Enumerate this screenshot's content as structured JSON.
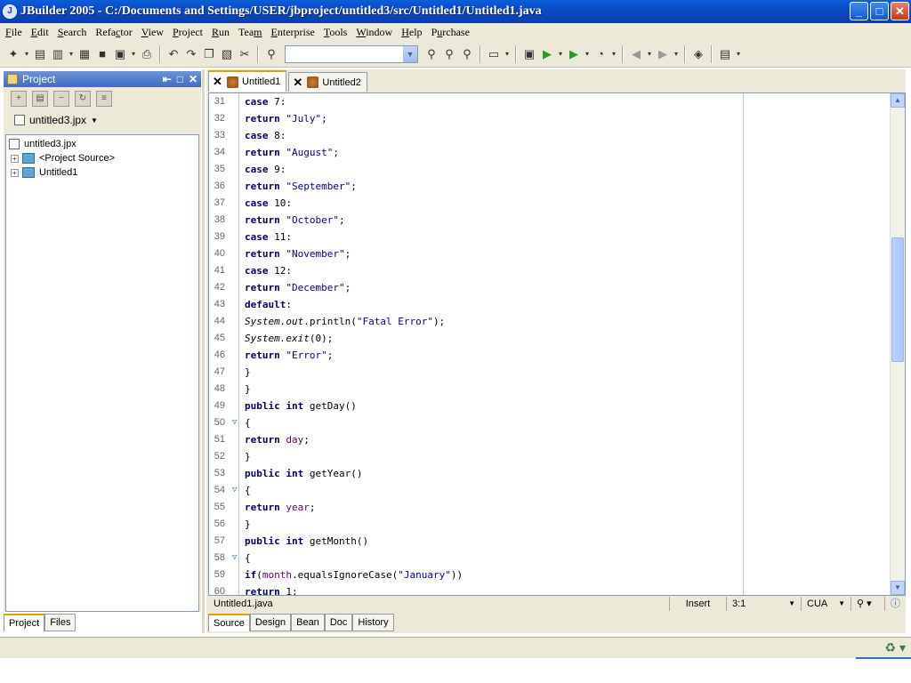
{
  "window": {
    "title": "JBuilder 2005 - C:/Documents and Settings/USER/jbproject/untitled3/src/Untitled1/Untitled1.java",
    "min": "_",
    "max": "□",
    "close": "✕"
  },
  "menu": [
    {
      "label": "File",
      "u": "F",
      "rest": "ile"
    },
    {
      "label": "Edit",
      "u": "E",
      "rest": "dit"
    },
    {
      "label": "Search",
      "u": "S",
      "rest": "earch"
    },
    {
      "label": "Refactor",
      "pre": "Refa",
      "u": "c",
      "rest": "tor"
    },
    {
      "label": "View",
      "u": "V",
      "rest": "iew"
    },
    {
      "label": "Project",
      "u": "P",
      "rest": "roject"
    },
    {
      "label": "Run",
      "u": "R",
      "rest": "un"
    },
    {
      "label": "Team",
      "pre": "Tea",
      "u": "m",
      "rest": ""
    },
    {
      "label": "Enterprise",
      "u": "E",
      "rest": "nterprise"
    },
    {
      "label": "Tools",
      "u": "T",
      "rest": "ools"
    },
    {
      "label": "Window",
      "u": "W",
      "rest": "indow"
    },
    {
      "label": "Help",
      "u": "H",
      "rest": "elp"
    },
    {
      "label": "Purchase",
      "pre": "P",
      "u": "u",
      "rest": "rchase"
    }
  ],
  "toolbar": {
    "search_combo_value": ""
  },
  "project_panel": {
    "title": "Project",
    "project_combo": "untitled3.jpx",
    "tree": [
      {
        "label": "untitled3.jpx",
        "type": "root"
      },
      {
        "label": "<Project Source>",
        "type": "folder"
      },
      {
        "label": "Untitled1",
        "type": "folder"
      }
    ],
    "tabs": [
      "Project",
      "Files"
    ],
    "active_tab": "Project"
  },
  "editor": {
    "tabs": [
      {
        "label": "Untitled1",
        "active": true
      },
      {
        "label": "Untitled2",
        "active": false
      }
    ],
    "lines": [
      {
        "n": "31",
        "fold": false,
        "code": [
          [
            "kw",
            "case"
          ],
          [
            "",
            "7:"
          ]
        ]
      },
      {
        "n": "32",
        "fold": false,
        "code": [
          [
            "kw",
            "return"
          ],
          [
            "str",
            "\"July\""
          ],
          [
            "",
            ";"
          ]
        ]
      },
      {
        "n": "33",
        "fold": false,
        "code": [
          [
            "kw",
            "case"
          ],
          [
            "",
            "8:"
          ]
        ]
      },
      {
        "n": "34",
        "fold": false,
        "code": [
          [
            "kw",
            "return"
          ],
          [
            "str",
            "\"August\""
          ],
          [
            "",
            ";"
          ]
        ]
      },
      {
        "n": "35",
        "fold": false,
        "code": [
          [
            "kw",
            "case"
          ],
          [
            "",
            "9:"
          ]
        ]
      },
      {
        "n": "36",
        "fold": false,
        "code": [
          [
            "kw",
            "return"
          ],
          [
            "str",
            "\"September\""
          ],
          [
            "",
            ";"
          ]
        ]
      },
      {
        "n": "37",
        "fold": false,
        "code": [
          [
            "kw",
            "case"
          ],
          [
            "",
            "10:"
          ]
        ]
      },
      {
        "n": "38",
        "fold": false,
        "code": [
          [
            "kw",
            "return"
          ],
          [
            "str",
            "\"October\""
          ],
          [
            "",
            ";"
          ]
        ]
      },
      {
        "n": "39",
        "fold": false,
        "code": [
          [
            "kw",
            "case"
          ],
          [
            "",
            "11:"
          ]
        ]
      },
      {
        "n": "40",
        "fold": false,
        "code": [
          [
            "kw",
            "return"
          ],
          [
            "str",
            "\"November\""
          ],
          [
            "",
            ";"
          ]
        ]
      },
      {
        "n": "41",
        "fold": false,
        "code": [
          [
            "kw",
            "case"
          ],
          [
            "",
            "12:"
          ]
        ]
      },
      {
        "n": "42",
        "fold": false,
        "code": [
          [
            "kw",
            "return"
          ],
          [
            "str",
            "\"December\""
          ],
          [
            "",
            ";"
          ]
        ]
      },
      {
        "n": "43",
        "fold": false,
        "code": [
          [
            "kw",
            "default"
          ],
          [
            "",
            ":"
          ]
        ]
      },
      {
        "n": "44",
        "fold": false,
        "code": [
          [
            "it",
            "System."
          ],
          [
            "it",
            "out"
          ],
          [
            "",
            ".println("
          ],
          [
            "str",
            "\"Fatal Error\""
          ],
          [
            "",
            ");"
          ]
        ]
      },
      {
        "n": "45",
        "fold": false,
        "code": [
          [
            "it",
            "System."
          ],
          [
            "it",
            "exit"
          ],
          [
            "",
            "(0);"
          ]
        ]
      },
      {
        "n": "46",
        "fold": false,
        "code": [
          [
            "kw",
            "return"
          ],
          [
            "str",
            "\"Error\""
          ],
          [
            "",
            ";"
          ]
        ]
      },
      {
        "n": "47",
        "fold": false,
        "code": [
          [
            "",
            "}"
          ]
        ]
      },
      {
        "n": "48",
        "fold": false,
        "code": [
          [
            "",
            "}"
          ]
        ]
      },
      {
        "n": "49",
        "fold": false,
        "code": [
          [
            "kw",
            "public int"
          ],
          [
            "",
            "getDay()"
          ]
        ]
      },
      {
        "n": "50",
        "fold": true,
        "code": [
          [
            "",
            "{"
          ]
        ]
      },
      {
        "n": "51",
        "fold": false,
        "code": [
          [
            "kw",
            "return"
          ],
          [
            "fld",
            "day"
          ],
          [
            "",
            ";"
          ]
        ]
      },
      {
        "n": "52",
        "fold": false,
        "code": [
          [
            "",
            "}"
          ]
        ]
      },
      {
        "n": "53",
        "fold": false,
        "code": [
          [
            "kw",
            "public int"
          ],
          [
            "",
            "getYear()"
          ]
        ]
      },
      {
        "n": "54",
        "fold": true,
        "code": [
          [
            "",
            "{"
          ]
        ]
      },
      {
        "n": "55",
        "fold": false,
        "code": [
          [
            "kw",
            "return"
          ],
          [
            "fld",
            "year"
          ],
          [
            "",
            ";"
          ]
        ]
      },
      {
        "n": "56",
        "fold": false,
        "code": [
          [
            "",
            "}"
          ]
        ]
      },
      {
        "n": "57",
        "fold": false,
        "code": [
          [
            "kw",
            "public int"
          ],
          [
            "",
            "getMonth()"
          ]
        ]
      },
      {
        "n": "58",
        "fold": true,
        "code": [
          [
            "",
            "{"
          ]
        ]
      },
      {
        "n": "59",
        "fold": false,
        "code": [
          [
            "kw",
            "if"
          ],
          [
            "",
            "("
          ],
          [
            "fld",
            "month"
          ],
          [
            "",
            ".equalsIgnoreCase("
          ],
          [
            "str",
            "\"January\""
          ],
          [
            "",
            "))"
          ]
        ]
      },
      {
        "n": "60",
        "fold": false,
        "code": [
          [
            "kw",
            "return"
          ],
          [
            "",
            "1;"
          ]
        ]
      }
    ],
    "status": {
      "file": "Untitled1.java",
      "mode": "Insert",
      "position": "3:1",
      "keymap": "CUA"
    },
    "bottom_tabs": [
      "Source",
      "Design",
      "Bean",
      "Doc",
      "History"
    ],
    "active_bottom_tab": "Source"
  }
}
